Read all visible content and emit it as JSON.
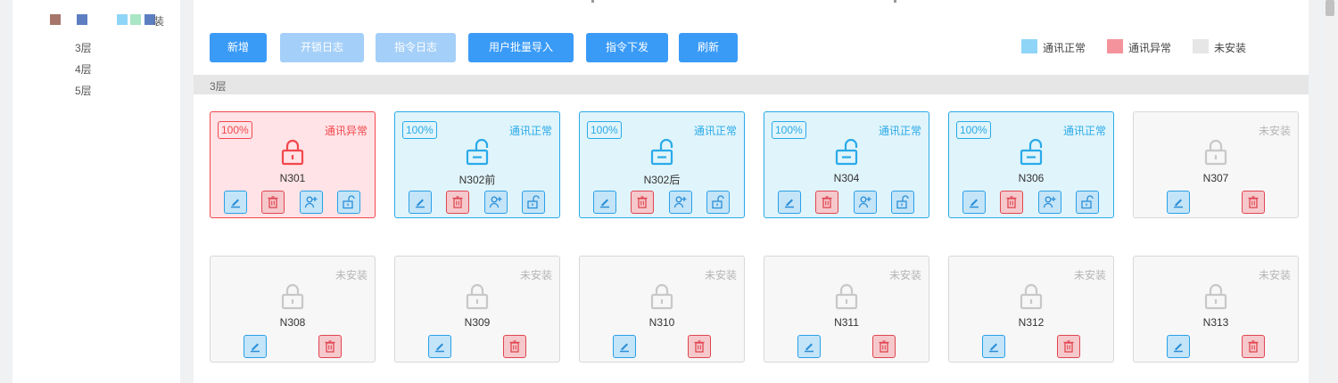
{
  "legend_swatches": [
    "#a6766a",
    "#5e7ec2",
    "#8ed5f7",
    "#a9e6c5",
    "#5e7ec2"
  ],
  "legend_swatch_label": "装",
  "tree": [
    "3层",
    "4层",
    "5层"
  ],
  "toolbar": {
    "add": "新增",
    "unlock_log": "开锁日志",
    "command_log": "指令日志",
    "batch_import": "用户批量导入",
    "command_send": "指令下发",
    "refresh": "刷新"
  },
  "legend": {
    "normal": {
      "label": "通讯正常",
      "color": "#8ed5f7"
    },
    "error": {
      "label": "通讯异常",
      "color": "#f4939b"
    },
    "none": {
      "label": "未安装",
      "color": "#e6e6e6"
    }
  },
  "floor_label": "3层",
  "rooms": [
    {
      "name": "N301",
      "status": "通讯异常",
      "type": "error",
      "pct": "100%"
    },
    {
      "name": "N302前",
      "status": "通讯正常",
      "type": "normal",
      "pct": "100%"
    },
    {
      "name": "N302后",
      "status": "通讯正常",
      "type": "normal",
      "pct": "100%"
    },
    {
      "name": "N304",
      "status": "通讯正常",
      "type": "normal",
      "pct": "100%"
    },
    {
      "name": "N306",
      "status": "通讯正常",
      "type": "normal",
      "pct": "100%"
    },
    {
      "name": "N307",
      "status": "未安装",
      "type": "none",
      "pct": ""
    },
    {
      "name": "N308",
      "status": "未安装",
      "type": "none",
      "pct": ""
    },
    {
      "name": "N309",
      "status": "未安装",
      "type": "none",
      "pct": ""
    },
    {
      "name": "N310",
      "status": "未安装",
      "type": "none",
      "pct": ""
    },
    {
      "name": "N311",
      "status": "未安装",
      "type": "none",
      "pct": ""
    },
    {
      "name": "N312",
      "status": "未安装",
      "type": "none",
      "pct": ""
    },
    {
      "name": "N313",
      "status": "未安装",
      "type": "none",
      "pct": ""
    }
  ],
  "colors": {
    "error": "#f3474d",
    "normal": "#29aae9",
    "none": "#c8c8c8",
    "primary": "#3a9bf7"
  }
}
